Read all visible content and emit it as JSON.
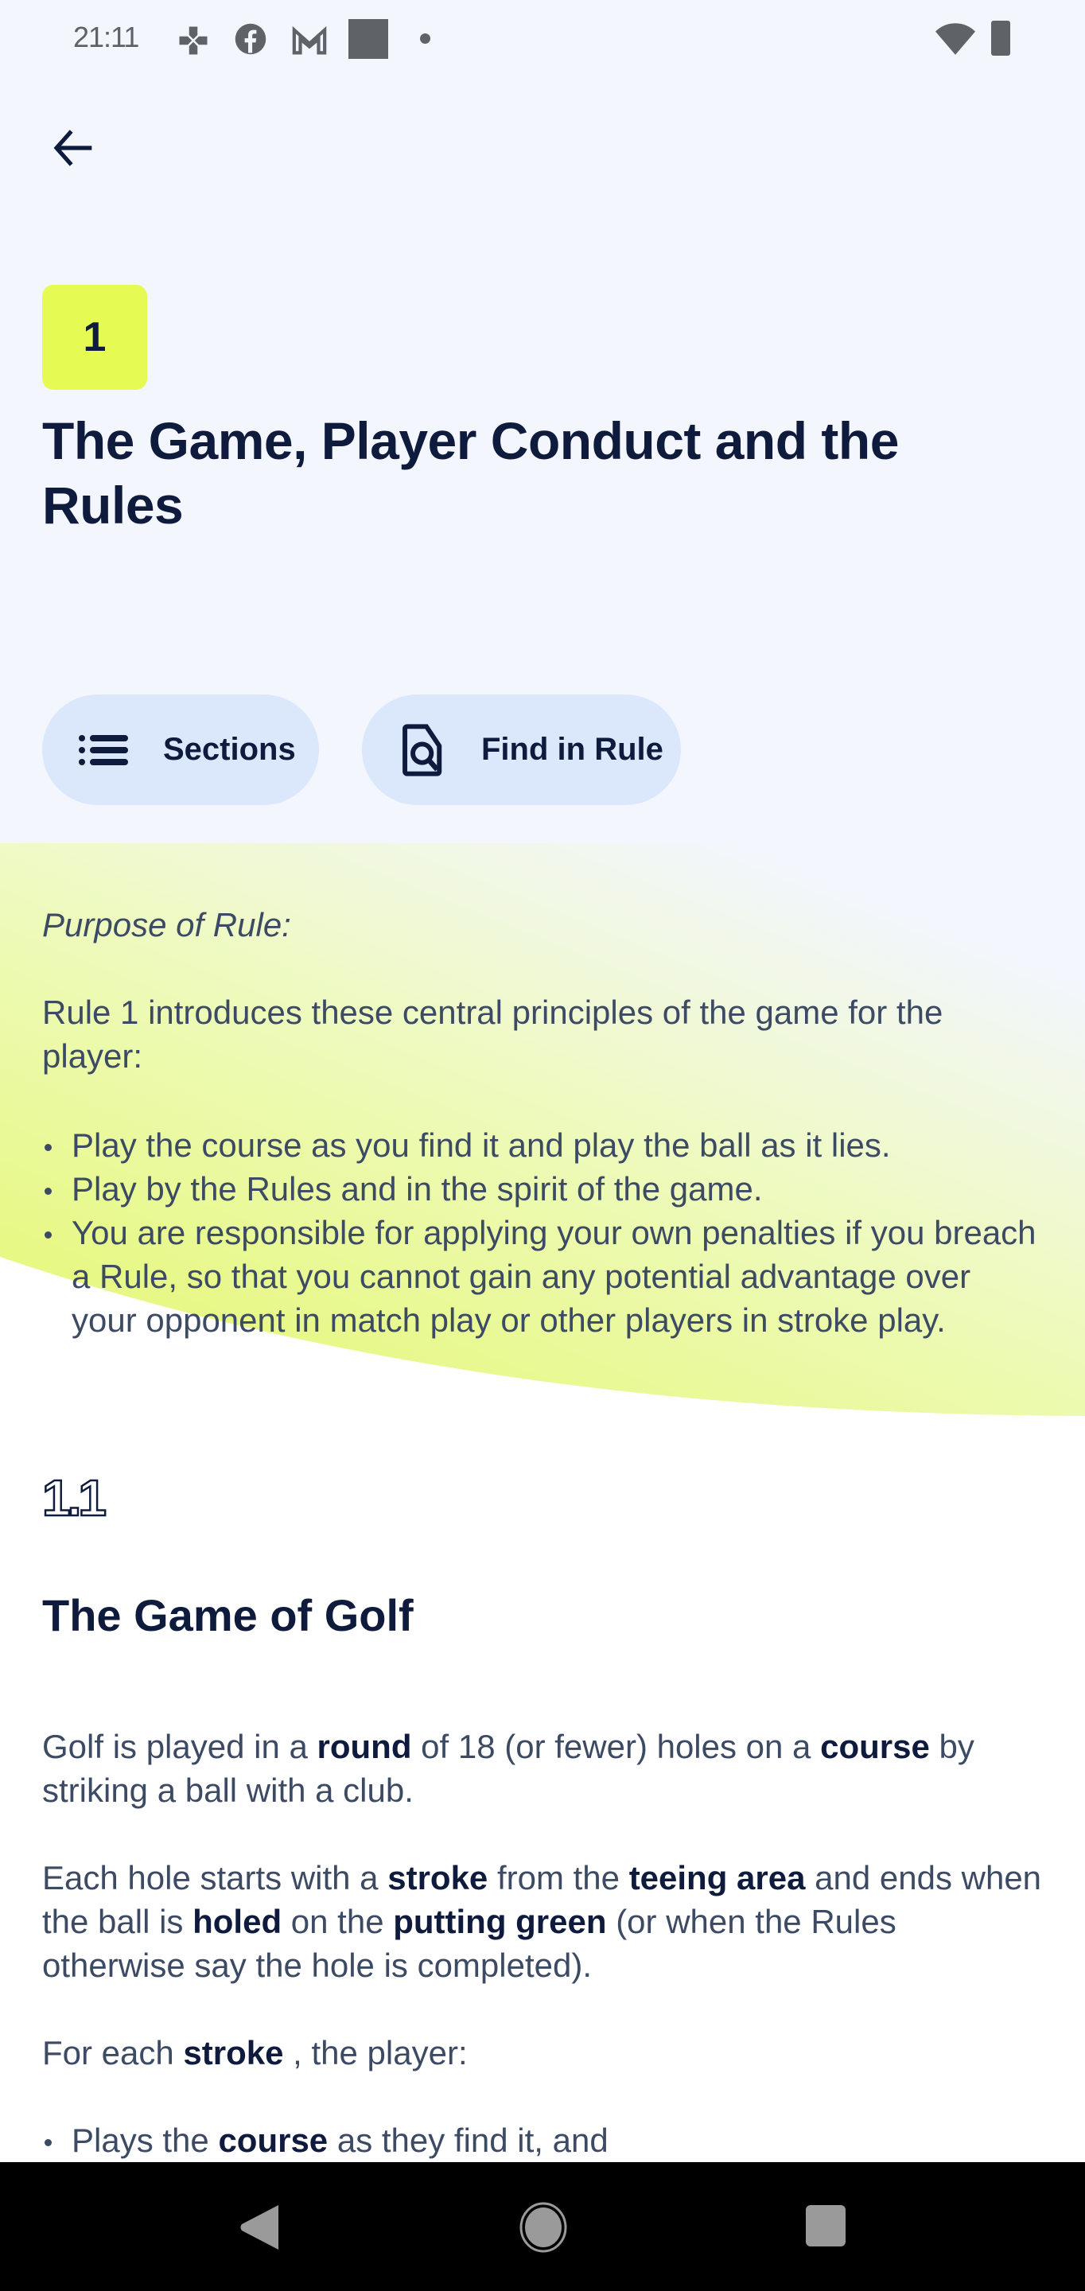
{
  "status_bar": {
    "time": "21:11",
    "notification_icons": [
      "game-controller-icon",
      "facebook-icon",
      "gmail-icon",
      "square-app-icon",
      "dot-icon"
    ],
    "system_icons": [
      "wifi-icon",
      "battery-icon"
    ]
  },
  "header": {
    "back_icon": "arrow-left-icon"
  },
  "rule": {
    "number": "1",
    "title": "The Game, Player Conduct and the Rules",
    "badge_color": "#e5fb54"
  },
  "actions": {
    "sections_label": "Sections",
    "find_label": "Find in Rule"
  },
  "purpose": {
    "label": "Purpose of Rule:",
    "intro": "Rule 1 introduces these central principles of the game for the player:",
    "bullets": [
      "Play the course as you find it and play the ball as it lies.",
      "Play by the Rules and in the spirit of the game.",
      "You are responsible for applying your own penalties if you breach a Rule, so that you cannot gain any potential advantage over your opponent in match play or other players in stroke play."
    ]
  },
  "section": {
    "number": "1.1",
    "title": "The Game of Golf",
    "para1": {
      "t1": "Golf is played in a ",
      "b1": "round",
      "t2": " of 18 (or fewer) holes on a ",
      "b2": "course",
      "t3": " by striking a ball with a club."
    },
    "para2": {
      "t1": "Each hole starts with a ",
      "b1": "stroke",
      "t2": " from the ",
      "b2": "teeing area",
      "t3": " and ends when the ball is ",
      "b3": "holed",
      "t4": " on the ",
      "b4": "putting green",
      "t5": " (or when the Rules otherwise say the hole is completed)."
    },
    "para3": {
      "t1": "For each ",
      "b1": "stroke",
      "t2": " , the player:"
    },
    "bullets": [
      {
        "t1": "Plays the ",
        "b1": "course",
        "t2": " as they find it, and"
      }
    ]
  },
  "nav_bar": {
    "back": "nav-back-icon",
    "home": "nav-home-icon",
    "recents": "nav-recents-icon"
  },
  "colors": {
    "background": "#f3f6fd",
    "text_dark": "#0f1b3d",
    "text_body": "#3d4a63",
    "button_bg": "#dbe7fb",
    "wave_yellow": "#e9f98a"
  }
}
